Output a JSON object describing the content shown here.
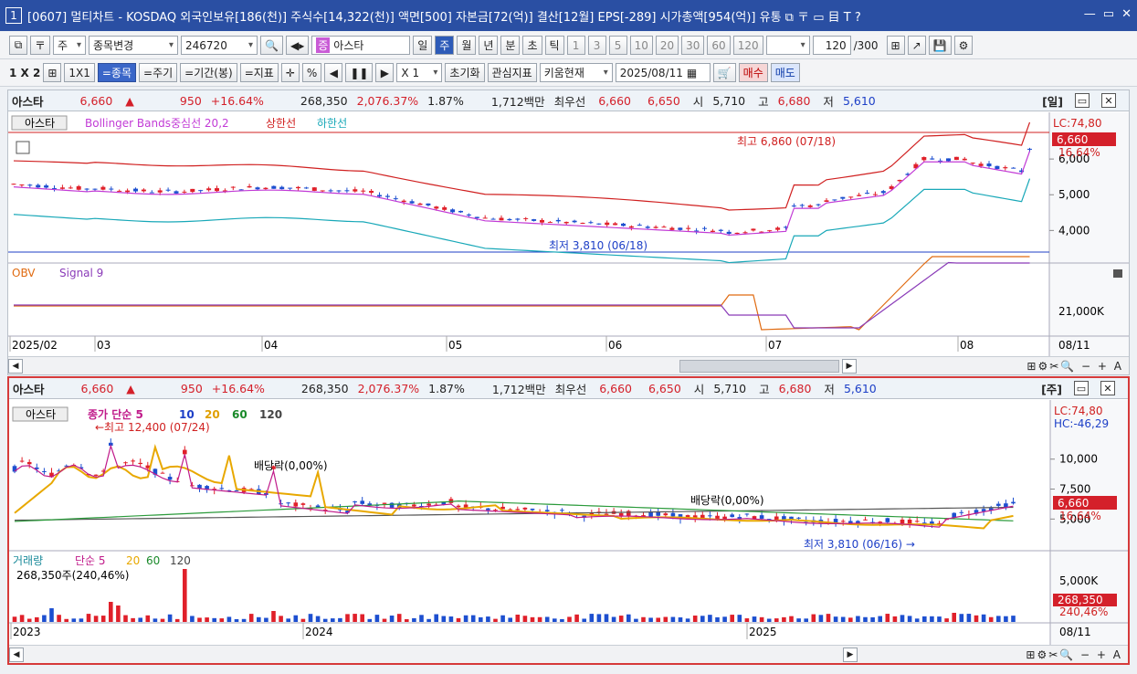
{
  "window": {
    "title": "[0607] 멀티차트 - KOSDAQ 외국인보유[186(천)] 주식수[14,322(천)] 액면[500] 자본금[72(억)] 결산[12월] EPS[-289] 시가총액[954(억)] 유통 ⧉ 〒 ▭ 目 T ?",
    "window_number": "1"
  },
  "toolbar1": {
    "market": "주",
    "stock_change": "종목변경",
    "code": "246720",
    "stock_name": "아스타",
    "stock_badge": "증",
    "periods": [
      "일",
      "주",
      "월",
      "년",
      "분",
      "초",
      "틱"
    ],
    "selected_period": "주",
    "minutes": [
      "1",
      "3",
      "5",
      "10",
      "20",
      "30",
      "60",
      "120"
    ],
    "count": "120",
    "count_total": "/300"
  },
  "toolbar2": {
    "layout": "1 X 2",
    "ratio": "1X1",
    "btn_stock": "=종목",
    "btn_period": "=주기",
    "btn_range": "=기간(봉)",
    "btn_indicator": "=지표",
    "percent": "%",
    "scale": "X 1",
    "reset": "초기화",
    "interest": "관심지표",
    "kiwoom": "키움현재",
    "date": "2025/08/11",
    "buy": "매수",
    "sell": "매도"
  },
  "panel_top": {
    "info": {
      "name": "아스타",
      "price": "6,660",
      "arrow": "▲",
      "change": "950",
      "rate": "+16.64%",
      "volume": "268,350",
      "vol_rate": "2,076.37%",
      "turnover": "1.87%",
      "amount": "1,712백만",
      "best_label": "최우선",
      "ask": "6,660",
      "bid": "6,650",
      "open_label": "시",
      "open": "5,710",
      "high_label": "고",
      "high": "6,680",
      "low_label": "저",
      "low": "5,610",
      "period_tag": "[일]"
    },
    "legend": {
      "stock": "아스타",
      "bb": "Bollinger Bands중심선 20,2",
      "upper": "상한선",
      "lower": "하한선"
    },
    "annotations": {
      "max": "최고 6,860 (07/18)",
      "min": "최저 3,810 (06/18)",
      "lc": "LC:74,80",
      "price": "6,660",
      "rate": "16,64%"
    },
    "y_ticks": [
      "6,000",
      "5,000",
      "4,000"
    ],
    "obv_legend": {
      "obv": "OBV",
      "signal": "Signal 9"
    },
    "obv_tick": "21,000K",
    "x_labels": [
      "2025/02",
      "03",
      "04",
      "05",
      "06",
      "07",
      "08",
      "08/11"
    ]
  },
  "panel_bottom": {
    "info": {
      "name": "아스타",
      "price": "6,660",
      "arrow": "▲",
      "change": "950",
      "rate": "+16.64%",
      "volume": "268,350",
      "vol_rate": "2,076.37%",
      "turnover": "1.87%",
      "amount": "1,712백만",
      "best_label": "최우선",
      "ask": "6,660",
      "bid": "6,650",
      "open_label": "시",
      "open": "5,710",
      "high_label": "고",
      "high": "6,680",
      "low_label": "저",
      "low": "5,610",
      "period_tag": "[주]"
    },
    "legend": {
      "stock": "아스타",
      "ma": "종가 단순 5",
      "ma10": "10",
      "ma20": "20",
      "ma60": "60",
      "ma120": "120"
    },
    "annotations": {
      "max": "←최고 12,400 (07/24)",
      "div1": "배당락(0,00%)",
      "div2": "배당락(0,00%)",
      "min": "최저 3,810 (06/16) →",
      "lc": "LC:74,80",
      "hc": "HC:-46,29",
      "price": "6,660",
      "rate": "16,64%"
    },
    "y_ticks": [
      "10,000",
      "7,500",
      "5,000"
    ],
    "vol_legend": {
      "vol": "거래량",
      "ma": "단순 5",
      "ma20": "20",
      "ma60": "60",
      "ma120": "120",
      "value": "268,350주(240,46%)"
    },
    "vol_tick": "5,000K",
    "vol_badge": "268,350",
    "vol_rate": "240,46%",
    "x_labels": [
      "2023",
      "2024",
      "2025",
      "08/11"
    ]
  },
  "colors": {
    "up": "#e0202a",
    "down": "#1d4fd0",
    "bb_mid": "#c23bd6",
    "bb_upper": "#d02020",
    "bb_lower": "#18a8b8",
    "obv": "#e06a10",
    "signal": "#8a3bb8"
  }
}
